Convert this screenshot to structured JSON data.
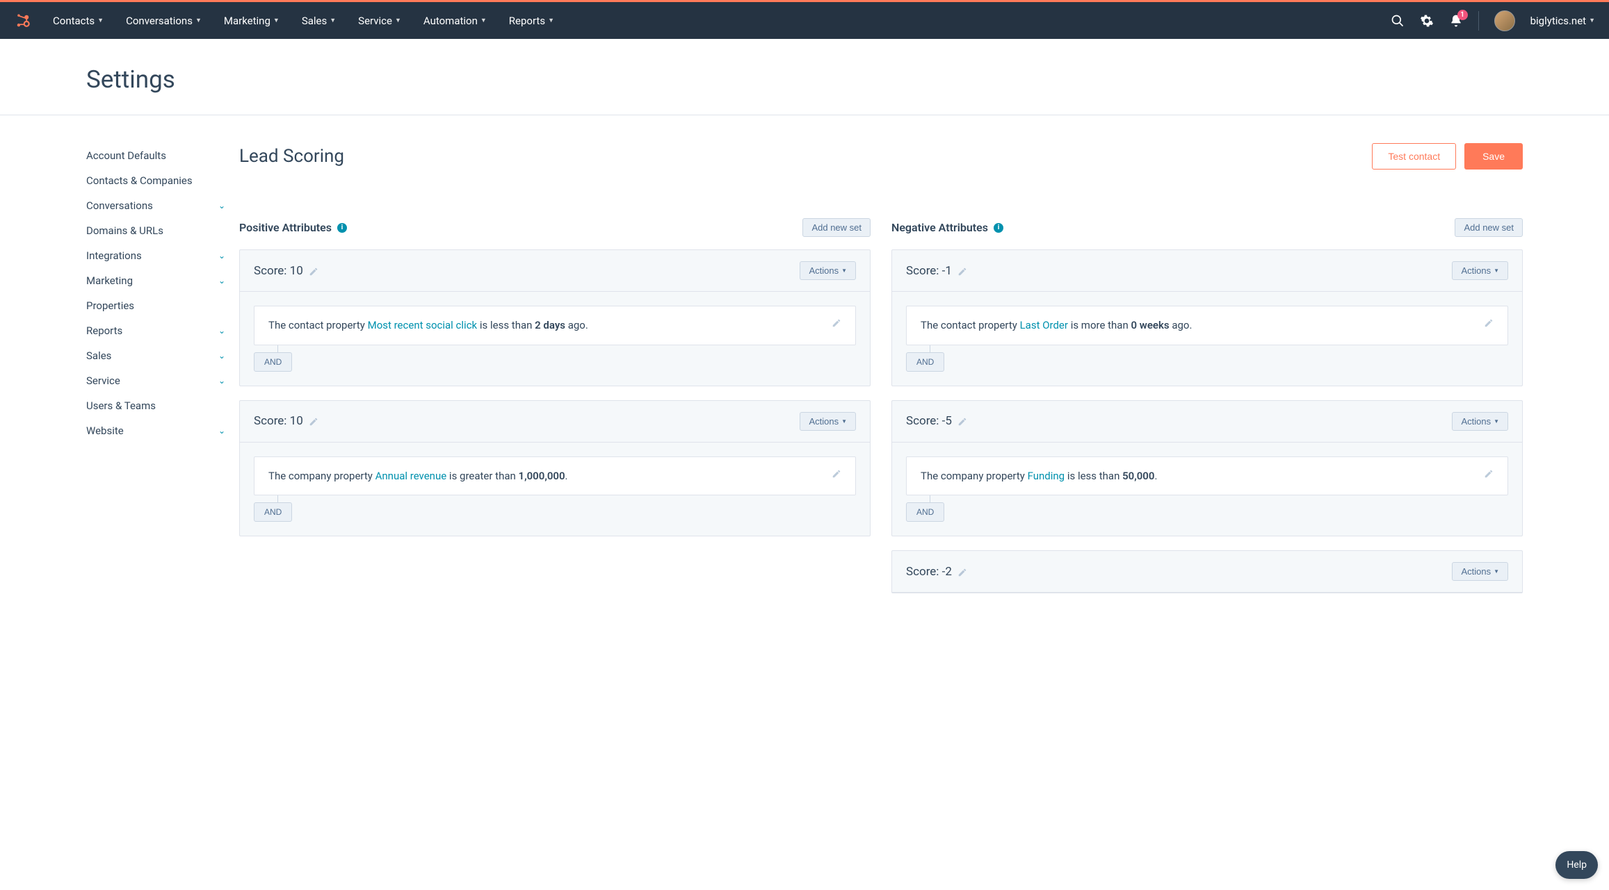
{
  "topnav": {
    "items": [
      {
        "label": "Contacts"
      },
      {
        "label": "Conversations"
      },
      {
        "label": "Marketing"
      },
      {
        "label": "Sales"
      },
      {
        "label": "Service"
      },
      {
        "label": "Automation"
      },
      {
        "label": "Reports"
      }
    ],
    "notif_count": "1",
    "account": "biglytics.net"
  },
  "page_title": "Settings",
  "sidebar": {
    "items": [
      {
        "label": "Account Defaults",
        "expandable": false
      },
      {
        "label": "Contacts & Companies",
        "expandable": false
      },
      {
        "label": "Conversations",
        "expandable": true
      },
      {
        "label": "Domains & URLs",
        "expandable": false
      },
      {
        "label": "Integrations",
        "expandable": true
      },
      {
        "label": "Marketing",
        "expandable": true
      },
      {
        "label": "Properties",
        "expandable": false
      },
      {
        "label": "Reports",
        "expandable": true
      },
      {
        "label": "Sales",
        "expandable": true
      },
      {
        "label": "Service",
        "expandable": true
      },
      {
        "label": "Users & Teams",
        "expandable": false
      },
      {
        "label": "Website",
        "expandable": true
      }
    ]
  },
  "main": {
    "title": "Lead Scoring",
    "test_btn": "Test contact",
    "save_btn": "Save"
  },
  "positive": {
    "title": "Positive Attributes",
    "add_btn": "Add new set",
    "cards": [
      {
        "score": "Score: 10",
        "actions": "Actions",
        "rule_pre": "The contact property ",
        "rule_link": "Most recent social click",
        "rule_mid": " is less than ",
        "rule_bold": "2 days",
        "rule_post": " ago.",
        "and": "AND"
      },
      {
        "score": "Score: 10",
        "actions": "Actions",
        "rule_pre": "The company property ",
        "rule_link": "Annual revenue",
        "rule_mid": " is greater than ",
        "rule_bold": "1,000,000",
        "rule_post": ".",
        "and": "AND"
      }
    ]
  },
  "negative": {
    "title": "Negative Attributes",
    "add_btn": "Add new set",
    "cards": [
      {
        "score": "Score: -1",
        "actions": "Actions",
        "rule_pre": "The contact property ",
        "rule_link": "Last Order",
        "rule_mid": " is more than ",
        "rule_bold": "0 weeks",
        "rule_post": " ago.",
        "and": "AND"
      },
      {
        "score": "Score: -5",
        "actions": "Actions",
        "rule_pre": "The company property ",
        "rule_link": "Funding",
        "rule_mid": " is less than ",
        "rule_bold": "50,000",
        "rule_post": ".",
        "and": "AND"
      },
      {
        "score": "Score: -2",
        "actions": "Actions"
      }
    ]
  },
  "help": "Help"
}
